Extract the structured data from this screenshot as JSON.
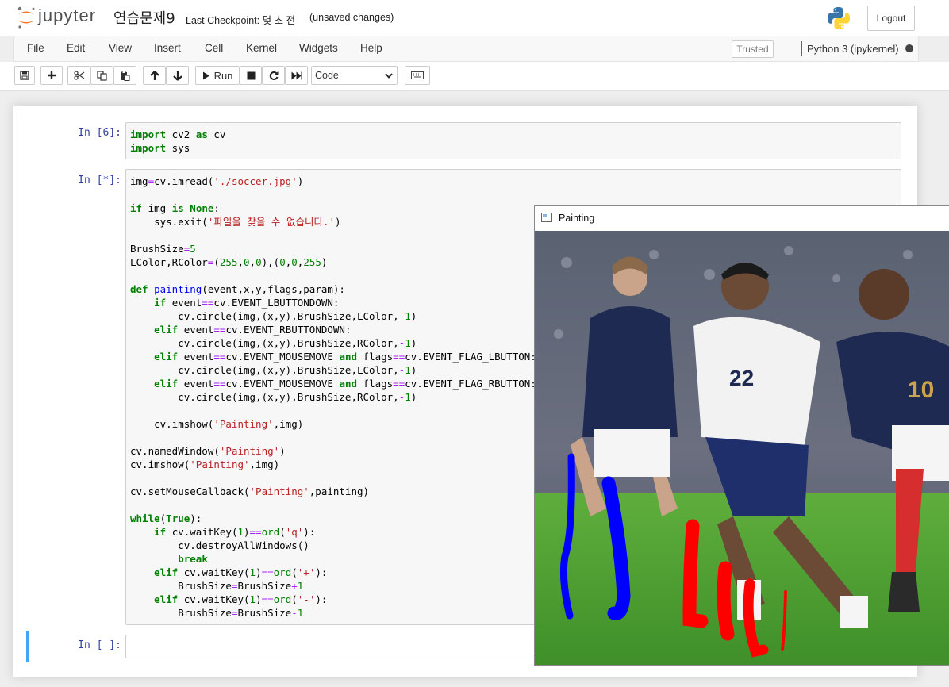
{
  "app": {
    "logo_text": "jupyter",
    "notebook_title": "연습문제9",
    "checkpoint": "Last Checkpoint: 몇 초 전",
    "unsaved": "(unsaved changes)",
    "logout_label": "Logout"
  },
  "menu": {
    "items": [
      "File",
      "Edit",
      "View",
      "Insert",
      "Cell",
      "Kernel",
      "Widgets",
      "Help"
    ],
    "trusted": "Trusted",
    "kernel_name": "Python 3 (ipykernel)"
  },
  "toolbar": {
    "run_label": "Run",
    "cell_type": "Code"
  },
  "cells": [
    {
      "prompt": "In [6]:"
    },
    {
      "prompt": "In [*]:"
    },
    {
      "prompt": "In [ ]:"
    }
  ],
  "window": {
    "title": "Painting"
  },
  "colors": {
    "prompt": "#303f9f",
    "keyword": "#008000",
    "string": "#ba2121",
    "operator": "#aa22ff",
    "function_name": "#0000ff",
    "selected_cell_bar": "#42a5f5"
  }
}
